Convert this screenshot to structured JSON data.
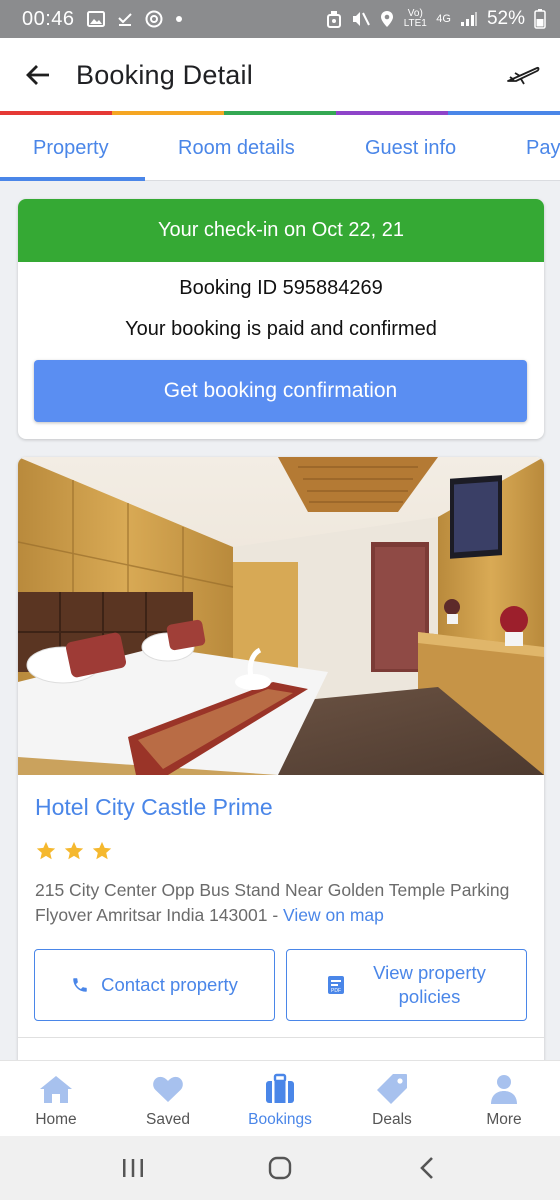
{
  "status_bar": {
    "time": "00:46",
    "network": "Vo) LTE1",
    "signal_type": "4G",
    "battery": "52%",
    "icons": [
      "image-icon",
      "download-done-icon",
      "chrome-icon",
      "dot-icon",
      "alarm-icon",
      "mute-icon",
      "location-icon",
      "signal-icon",
      "battery-icon"
    ]
  },
  "header": {
    "title": "Booking Detail",
    "colors": [
      "#e53935",
      "#f5a623",
      "#34a853",
      "#8e44c9",
      "#4a86e8"
    ]
  },
  "tabs": [
    {
      "label": "Property",
      "active": true
    },
    {
      "label": "Room details",
      "active": false
    },
    {
      "label": "Guest info",
      "active": false
    },
    {
      "label": "Pay",
      "active": false
    }
  ],
  "confirmation": {
    "checkin_text": "Your check-in on Oct 22, 21",
    "booking_id": "Booking ID 595884269",
    "status_text": "Your booking is paid and confirmed",
    "button_label": "Get booking confirmation",
    "banner_color": "#35a934",
    "button_color": "#5a8ef2"
  },
  "hotel": {
    "name": "Hotel City Castle Prime",
    "star_rating": 3,
    "address": "215 City Center Opp Bus Stand Near Golden Temple Parking Flyover Amritsar India 143001 - ",
    "map_link": "View on map",
    "contact_label": "Contact property",
    "policies_label_line1": "View property",
    "policies_label_line2": "policies"
  },
  "bottom_nav": [
    {
      "label": "Home",
      "icon": "home-icon",
      "active": false
    },
    {
      "label": "Saved",
      "icon": "heart-icon",
      "active": false
    },
    {
      "label": "Bookings",
      "icon": "suitcase-icon",
      "active": true
    },
    {
      "label": "Deals",
      "icon": "tag-icon",
      "active": false
    },
    {
      "label": "More",
      "icon": "person-icon",
      "active": false
    }
  ],
  "accent_color": "#4a86e8"
}
